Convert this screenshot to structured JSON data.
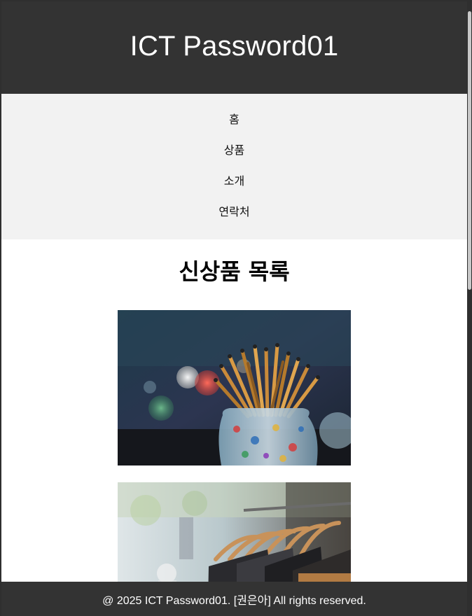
{
  "header": {
    "title": "ICT Password01"
  },
  "nav": {
    "items": [
      {
        "label": "홈"
      },
      {
        "label": "상품"
      },
      {
        "label": "소개"
      },
      {
        "label": "연락처"
      }
    ]
  },
  "main": {
    "heading": "신상품 목록",
    "products": [
      {
        "image": "paintbrushes-in-jar"
      },
      {
        "image": "clothes-on-rack"
      }
    ]
  },
  "footer": {
    "text": "@ 2025 ICT Password01. [권은아] All rights reserved."
  },
  "colors": {
    "header_bg": "#333333",
    "nav_bg": "#f2f2f2",
    "footer_bg": "#333333"
  }
}
